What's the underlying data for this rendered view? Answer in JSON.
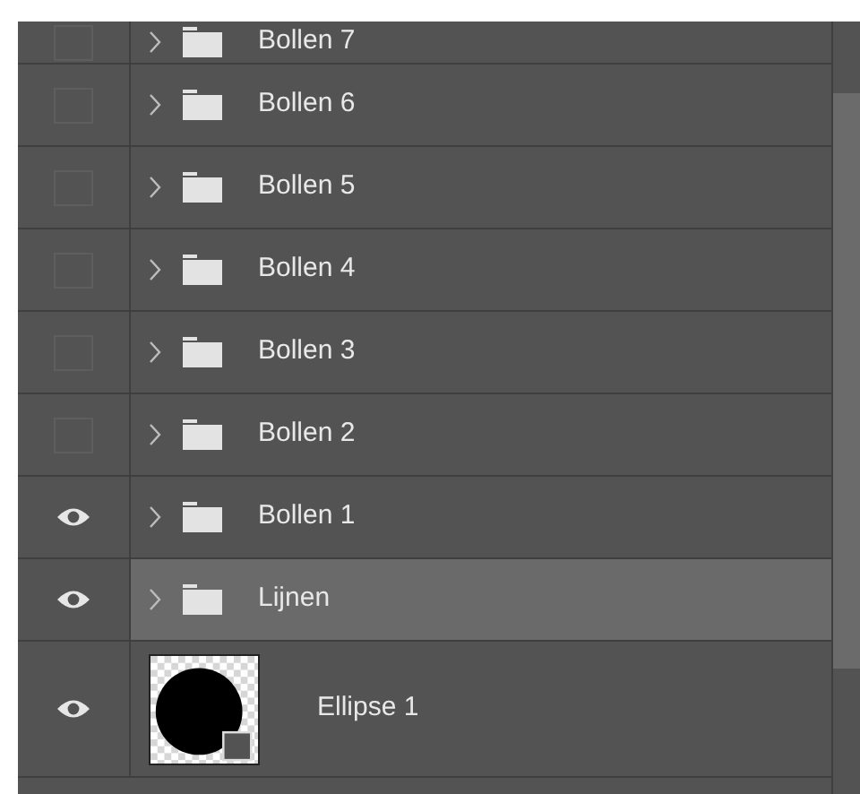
{
  "layers": [
    {
      "kind": "group",
      "name": "Bollen 7",
      "visible": false,
      "selected": false
    },
    {
      "kind": "group",
      "name": "Bollen 6",
      "visible": false,
      "selected": false
    },
    {
      "kind": "group",
      "name": "Bollen 5",
      "visible": false,
      "selected": false
    },
    {
      "kind": "group",
      "name": "Bollen 4",
      "visible": false,
      "selected": false
    },
    {
      "kind": "group",
      "name": "Bollen 3",
      "visible": false,
      "selected": false
    },
    {
      "kind": "group",
      "name": "Bollen 2",
      "visible": false,
      "selected": false
    },
    {
      "kind": "group",
      "name": "Bollen 1",
      "visible": true,
      "selected": false
    },
    {
      "kind": "group",
      "name": "Lijnen",
      "visible": true,
      "selected": true
    },
    {
      "kind": "shape",
      "name": "Ellipse 1",
      "visible": true,
      "selected": false
    }
  ]
}
